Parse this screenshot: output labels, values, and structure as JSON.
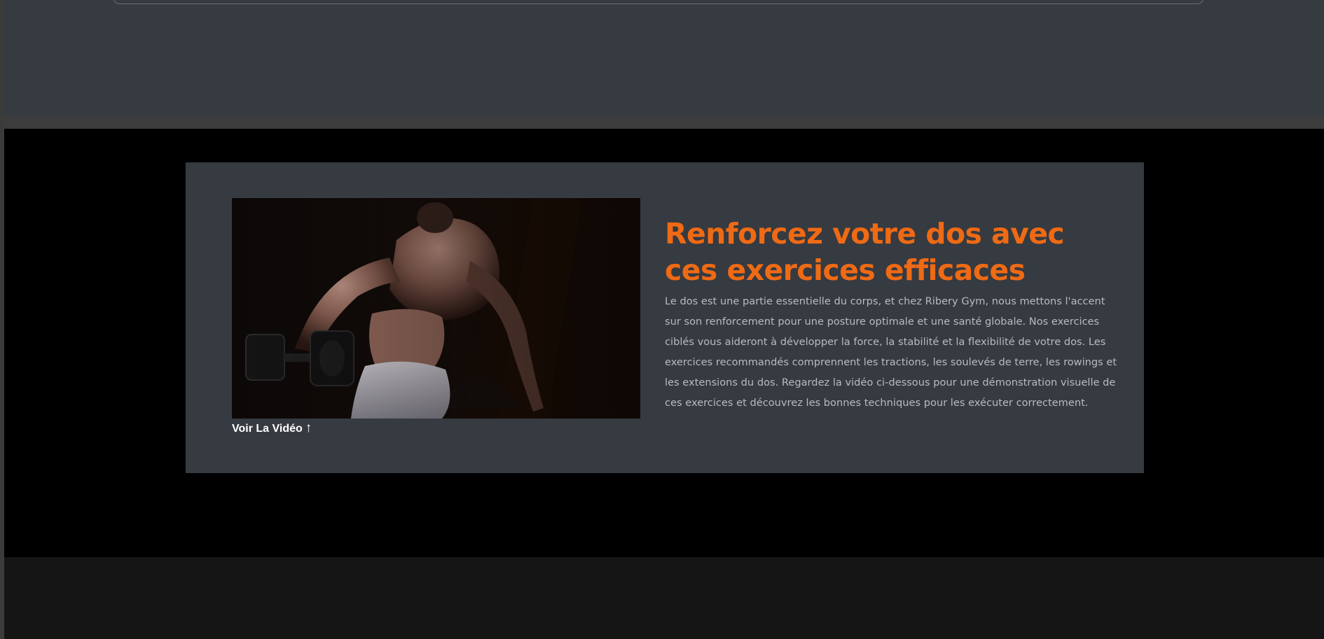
{
  "section": {
    "image_alt": "Homme musclé soulevant un haltère",
    "video_link_label": "Voir La Vidéo",
    "video_link_arrow": "↑",
    "headline": "Renforcez votre dos avec ces exercices efficaces",
    "body": "Le dos est une partie essentielle du corps, et chez Ribery Gym, nous mettons l'accent sur son renforcement pour une posture optimale et une santé globale. Nos exercices ciblés vous aideront à développer la force, la stabilité et la flexibilité de votre dos. Les exercices recommandés comprennent les tractions, les soulevés de terre, les rowings et les extensions du dos. Regardez la vidéo ci-dessous pour une démonstration visuelle de ces exercices et découvrez les bonnes techniques pour les exécuter correctement."
  },
  "colors": {
    "accent": "#ef6a14",
    "card_background": "#363a41",
    "section_background": "#000000",
    "top_band": "#363b42",
    "body_text": "#b9bbbf"
  }
}
